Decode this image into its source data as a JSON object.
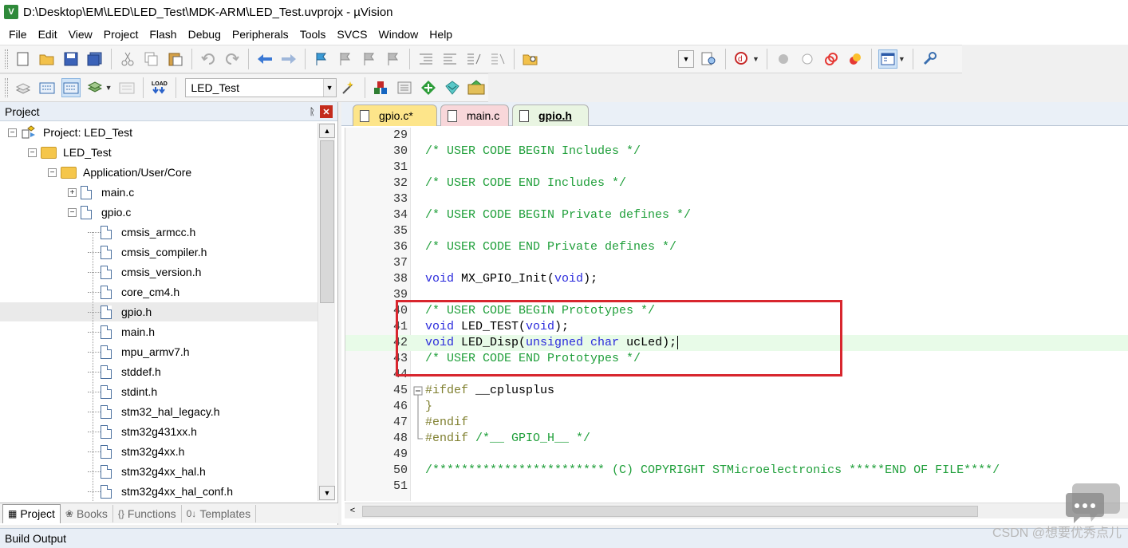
{
  "window": {
    "title": "D:\\Desktop\\EM\\LED\\LED_Test\\MDK-ARM\\LED_Test.uvprojx - µVision",
    "app_icon_letter": "V"
  },
  "menu": [
    "File",
    "Edit",
    "View",
    "Project",
    "Flash",
    "Debug",
    "Peripherals",
    "Tools",
    "SVCS",
    "Window",
    "Help"
  ],
  "toolbar": {
    "target_name": "LED_Test"
  },
  "project_panel": {
    "title": "Project",
    "pin": "ᚱ",
    "close": "✕",
    "tree": [
      {
        "label": "Project: LED_Test",
        "level": 0,
        "expander": "−",
        "icon": "project-icon"
      },
      {
        "label": "LED_Test",
        "level": 1,
        "expander": "−",
        "icon": "folder-icon"
      },
      {
        "label": "Application/User/Core",
        "level": 2,
        "expander": "−",
        "icon": "folder-icon"
      },
      {
        "label": "main.c",
        "level": 3,
        "expander": "+",
        "icon": "file-icon"
      },
      {
        "label": "gpio.c",
        "level": 3,
        "expander": "−",
        "icon": "file-icon"
      },
      {
        "label": "cmsis_armcc.h",
        "level": 4,
        "icon": "file-icon"
      },
      {
        "label": "cmsis_compiler.h",
        "level": 4,
        "icon": "file-icon"
      },
      {
        "label": "cmsis_version.h",
        "level": 4,
        "icon": "file-icon"
      },
      {
        "label": "core_cm4.h",
        "level": 4,
        "icon": "file-icon"
      },
      {
        "label": "gpio.h",
        "level": 4,
        "icon": "file-icon",
        "selected": true
      },
      {
        "label": "main.h",
        "level": 4,
        "icon": "file-icon"
      },
      {
        "label": "mpu_armv7.h",
        "level": 4,
        "icon": "file-icon"
      },
      {
        "label": "stddef.h",
        "level": 4,
        "icon": "file-icon"
      },
      {
        "label": "stdint.h",
        "level": 4,
        "icon": "file-icon"
      },
      {
        "label": "stm32_hal_legacy.h",
        "level": 4,
        "icon": "file-icon"
      },
      {
        "label": "stm32g431xx.h",
        "level": 4,
        "icon": "file-icon"
      },
      {
        "label": "stm32g4xx.h",
        "level": 4,
        "icon": "file-icon"
      },
      {
        "label": "stm32g4xx_hal.h",
        "level": 4,
        "icon": "file-icon"
      },
      {
        "label": "stm32g4xx_hal_conf.h",
        "level": 4,
        "icon": "file-icon"
      }
    ],
    "tabs": [
      {
        "label": "Project",
        "icon": "▦",
        "active": true
      },
      {
        "label": "Books",
        "icon": "❀"
      },
      {
        "label": "Functions",
        "icon": "{}"
      },
      {
        "label": "Templates",
        "icon": "0↓"
      }
    ]
  },
  "editor": {
    "tabs": [
      {
        "label": "gpio.c*",
        "color": "#fde58a"
      },
      {
        "label": "main.c",
        "color": "#f8d7da"
      },
      {
        "label": "gpio.h",
        "color": "#e9f5e2",
        "active": true
      }
    ],
    "lines": [
      {
        "n": "29",
        "tokens": []
      },
      {
        "n": "30",
        "tokens": [
          {
            "t": "/* USER CODE BEGIN Includes */",
            "c": "com"
          }
        ]
      },
      {
        "n": "31",
        "tokens": []
      },
      {
        "n": "32",
        "tokens": [
          {
            "t": "/* USER CODE END Includes */",
            "c": "com"
          }
        ]
      },
      {
        "n": "33",
        "tokens": []
      },
      {
        "n": "34",
        "tokens": [
          {
            "t": "/* USER CODE BEGIN Private defines */",
            "c": "com"
          }
        ]
      },
      {
        "n": "35",
        "tokens": []
      },
      {
        "n": "36",
        "tokens": [
          {
            "t": "/* USER CODE END Private defines */",
            "c": "com"
          }
        ]
      },
      {
        "n": "37",
        "tokens": []
      },
      {
        "n": "38",
        "tokens": [
          {
            "t": "void",
            "c": "kw"
          },
          {
            "t": " MX_GPIO_Init(",
            "c": "id"
          },
          {
            "t": "void",
            "c": "kw"
          },
          {
            "t": ");",
            "c": "id"
          }
        ]
      },
      {
        "n": "39",
        "tokens": []
      },
      {
        "n": "40",
        "tokens": [
          {
            "t": "/* USER CODE BEGIN Prototypes */",
            "c": "com"
          }
        ]
      },
      {
        "n": "41",
        "tokens": [
          {
            "t": "void",
            "c": "kw"
          },
          {
            "t": " LED_TEST(",
            "c": "id"
          },
          {
            "t": "void",
            "c": "kw"
          },
          {
            "t": ");",
            "c": "id"
          }
        ]
      },
      {
        "n": "42",
        "tokens": [
          {
            "t": "void",
            "c": "kw"
          },
          {
            "t": " LED_Disp(",
            "c": "id"
          },
          {
            "t": "unsigned char",
            "c": "kw"
          },
          {
            "t": " ucLed);",
            "c": "id"
          }
        ],
        "current": true
      },
      {
        "n": "43",
        "tokens": [
          {
            "t": "/* USER CODE END Prototypes */",
            "c": "com"
          }
        ]
      },
      {
        "n": "44",
        "tokens": []
      },
      {
        "n": "45",
        "tokens": [
          {
            "t": "#ifdef",
            "c": "pp"
          },
          {
            "t": " __cplusplus",
            "c": "id"
          }
        ],
        "fold": "box"
      },
      {
        "n": "46",
        "tokens": [
          {
            "t": "}",
            "c": "pp"
          }
        ],
        "fold": "line"
      },
      {
        "n": "47",
        "tokens": [
          {
            "t": "#endif",
            "c": "pp"
          }
        ],
        "fold": "line"
      },
      {
        "n": "48",
        "tokens": [
          {
            "t": "#endif",
            "c": "pp"
          },
          {
            "t": " /*__ GPIO_H__ */",
            "c": "com"
          }
        ],
        "fold": "end"
      },
      {
        "n": "49",
        "tokens": []
      },
      {
        "n": "50",
        "tokens": [
          {
            "t": "/************************ (C) COPYRIGHT STMicroelectronics *****END OF FILE****/",
            "c": "com"
          }
        ]
      },
      {
        "n": "51",
        "tokens": []
      }
    ]
  },
  "build_output": {
    "title": "Build Output"
  },
  "watermark": "CSDN @想要优秀点儿",
  "colors": {
    "highlight_box": "#d8262e",
    "comment": "#1f9f3a",
    "keyword": "#2b2bdc"
  }
}
